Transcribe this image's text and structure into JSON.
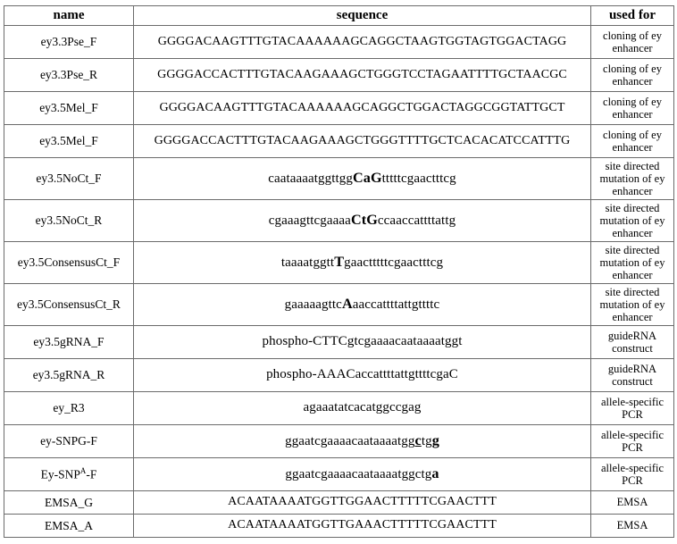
{
  "table": {
    "headers": {
      "name": "name",
      "sequence": "sequence",
      "used_for": "used for"
    },
    "rows": [
      {
        "name": "ey3.3Pse_F",
        "sequence": "GGGGACAAGTTTGTACAAAAAAGCAGGCTAAGTGGTAGTGGACTAGG",
        "used_for": "cloning of ey enhancer",
        "case": "upper",
        "height": "mid"
      },
      {
        "name": "ey3.3Pse_R",
        "sequence": "GGGGACCACTTTGTACAAGAAAGCTGGGTCCTAGAATTTTGCTAACGC",
        "used_for": "cloning of ey enhancer",
        "case": "upper",
        "height": "mid"
      },
      {
        "name": "ey3.5Mel_F",
        "sequence": "GGGGACAAGTTTGTACAAAAAAGCAGGCTGGACTAGGCGGTATTGCT",
        "used_for": "cloning of ey enhancer",
        "case": "upper",
        "height": "mid"
      },
      {
        "name": "ey3.5Mel_F",
        "sequence": "GGGGACCACTTTGTACAAGAAAGCTGGGTTTTGCTCACACATCCATTTG",
        "used_for": "cloning of ey enhancer",
        "case": "upper",
        "height": "mid"
      },
      {
        "name": "ey3.5NoCt_F",
        "sequence": "caataaaatggttggCaGtttttcgaactttcg",
        "sequence_parts": [
          {
            "text": "caataaaatggttgg",
            "style": "plain"
          },
          {
            "text": "CaG",
            "style": "bold"
          },
          {
            "text": "tttttcgaactttcg",
            "style": "plain"
          }
        ],
        "used_for": "site directed mutation of ey enhancer",
        "case": "lower",
        "height": "tall"
      },
      {
        "name": "ey3.5NoCt_R",
        "sequence": "cgaaagttcgaaaaCtGccaaccattttattg",
        "sequence_parts": [
          {
            "text": "cgaaagttcgaaaa",
            "style": "plain"
          },
          {
            "text": "CtG",
            "style": "bold"
          },
          {
            "text": "ccaaccattttattg",
            "style": "plain"
          }
        ],
        "used_for": "site directed mutation of ey enhancer",
        "case": "lower",
        "height": "tall"
      },
      {
        "name": "ey3.5ConsensusCt_F",
        "sequence": "taaaatggttTgaactttttcgaactttcg",
        "sequence_parts": [
          {
            "text": "taaaatggtt",
            "style": "plain"
          },
          {
            "text": "T",
            "style": "bold"
          },
          {
            "text": "gaactttttcgaactttcg",
            "style": "plain"
          }
        ],
        "used_for": "site directed mutation of ey enhancer",
        "case": "lower",
        "height": "tall"
      },
      {
        "name": "ey3.5ConsensusCt_R",
        "sequence": "gaaaaagttcAaaccattttattgttttc",
        "sequence_parts": [
          {
            "text": "gaaaaagttc",
            "style": "plain"
          },
          {
            "text": "A",
            "style": "bold"
          },
          {
            "text": "aaccattttattgttttc",
            "style": "plain"
          }
        ],
        "used_for": "site directed mutation of ey enhancer",
        "case": "lower",
        "height": "tall"
      },
      {
        "name": "ey3.5gRNA_F",
        "sequence": "phospho-CTTCgtcgaaaacaataaaatggt",
        "used_for": "guideRNA construct",
        "case": "lower",
        "height": "mid"
      },
      {
        "name": "ey3.5gRNA_R",
        "sequence": "phospho-AAACaccattttattgttttcgaC",
        "used_for": "guideRNA construct",
        "case": "lower",
        "height": "mid"
      },
      {
        "name": "ey_R3",
        "sequence": "agaaatatcacatggccgag",
        "used_for": "allele-specific PCR",
        "case": "lower",
        "height": "mid"
      },
      {
        "name": "ey-SNPG-F",
        "sequence": "ggaatcgaaaacaataaaatggctgg",
        "sequence_parts": [
          {
            "text": "ggaatcgaaaacaataaaatgg",
            "style": "plain"
          },
          {
            "text": "c",
            "style": "bold-underline"
          },
          {
            "text": "tg",
            "style": "plain"
          },
          {
            "text": "g",
            "style": "bold"
          }
        ],
        "used_for": "allele-specific PCR",
        "case": "lower",
        "height": "mid"
      },
      {
        "name": "Ey-SNP^A-F",
        "name_parts": [
          {
            "text": "Ey-SNP",
            "style": "plain"
          },
          {
            "text": "A",
            "style": "superscript"
          },
          {
            "text": "-F",
            "style": "plain"
          }
        ],
        "sequence": "ggaatcgaaaacaataaaatggctga",
        "sequence_parts": [
          {
            "text": "ggaatcgaaaacaataaaatggctg",
            "style": "plain"
          },
          {
            "text": "a",
            "style": "bold"
          }
        ],
        "used_for": "allele-specific PCR",
        "case": "lower",
        "height": "mid"
      },
      {
        "name": "EMSA_G",
        "sequence": "ACAATAAAATGGTTGGAACTTTTTCGAACTTT",
        "used_for": "EMSA",
        "case": "upper",
        "height": "short"
      },
      {
        "name": "EMSA_A",
        "sequence": "ACAATAAAATGGTTGAAACTTTTTCGAACTTT",
        "used_for": "EMSA",
        "case": "upper",
        "height": "short"
      }
    ]
  }
}
